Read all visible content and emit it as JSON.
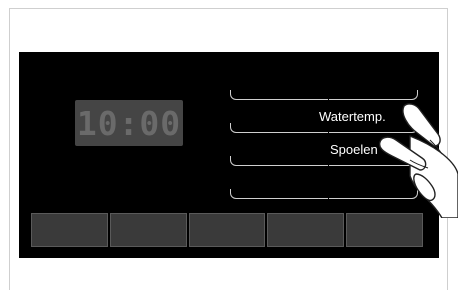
{
  "display": {
    "time": "10:00"
  },
  "options": [
    {
      "label": ""
    },
    {
      "label": "Watertemp."
    },
    {
      "label": "Spoelen"
    },
    {
      "label": ""
    }
  ],
  "buttons": [
    "",
    "",
    "",
    "",
    ""
  ],
  "colors": {
    "panel": "#000000",
    "display": "#454545",
    "button": "#3a3a3a",
    "label": "#ffffff"
  },
  "icons": [
    "hand-pointer-icon"
  ]
}
